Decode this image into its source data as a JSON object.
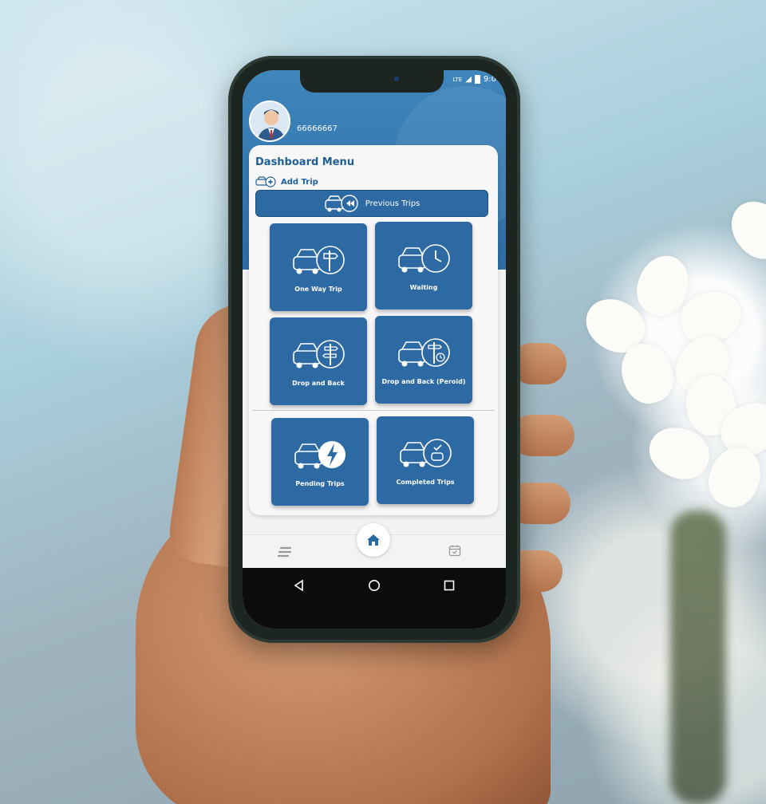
{
  "user": {
    "phone": "66666667"
  },
  "dashboard": {
    "title": "Dashboard Menu",
    "add_trip": "Add Trip",
    "previous_trips": "Previous Trips",
    "tiles": [
      {
        "label": "One Way Trip",
        "icon": "car-signpost-icon"
      },
      {
        "label": "Waiting",
        "icon": "car-clock-icon"
      },
      {
        "label": "Drop and Back",
        "icon": "car-double-sign-icon"
      },
      {
        "label": "Drop and Back (Peroid)",
        "icon": "car-sign-period-icon"
      },
      {
        "label": "Pending Trips",
        "icon": "car-lightning-icon"
      },
      {
        "label": "Completed Trips",
        "icon": "car-completed-icon"
      }
    ]
  },
  "status_bar": {
    "network": "LTE",
    "time": "9:0"
  },
  "colors": {
    "primary": "#2d6aa3",
    "header": "#3f86bd",
    "title": "#1f5f98"
  },
  "nav": {
    "left": "menu-icon",
    "center": "home-icon",
    "right": "calendar-icon"
  }
}
